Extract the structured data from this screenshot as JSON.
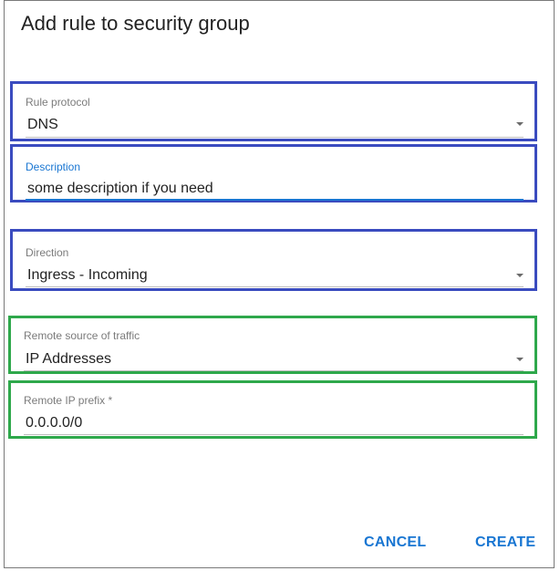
{
  "dialog": {
    "title": "Add rule to security group"
  },
  "fields": {
    "rule_protocol": {
      "label": "Rule protocol",
      "value": "DNS"
    },
    "description": {
      "label": "Description",
      "value": "some description if you need"
    },
    "direction": {
      "label": "Direction",
      "value": "Ingress - Incoming"
    },
    "remote_source": {
      "label": "Remote source of traffic",
      "value": "IP Addresses"
    },
    "remote_ip_prefix": {
      "label": "Remote IP prefix *",
      "value": "0.0.0.0/0"
    }
  },
  "actions": {
    "cancel_label": "CANCEL",
    "create_label": "CREATE"
  },
  "colors": {
    "accent": "#1976d2",
    "highlight_blue": "#3a4bbf",
    "highlight_green": "#2ea84b"
  },
  "icons": {
    "select_caret": "chevron-down-icon"
  }
}
